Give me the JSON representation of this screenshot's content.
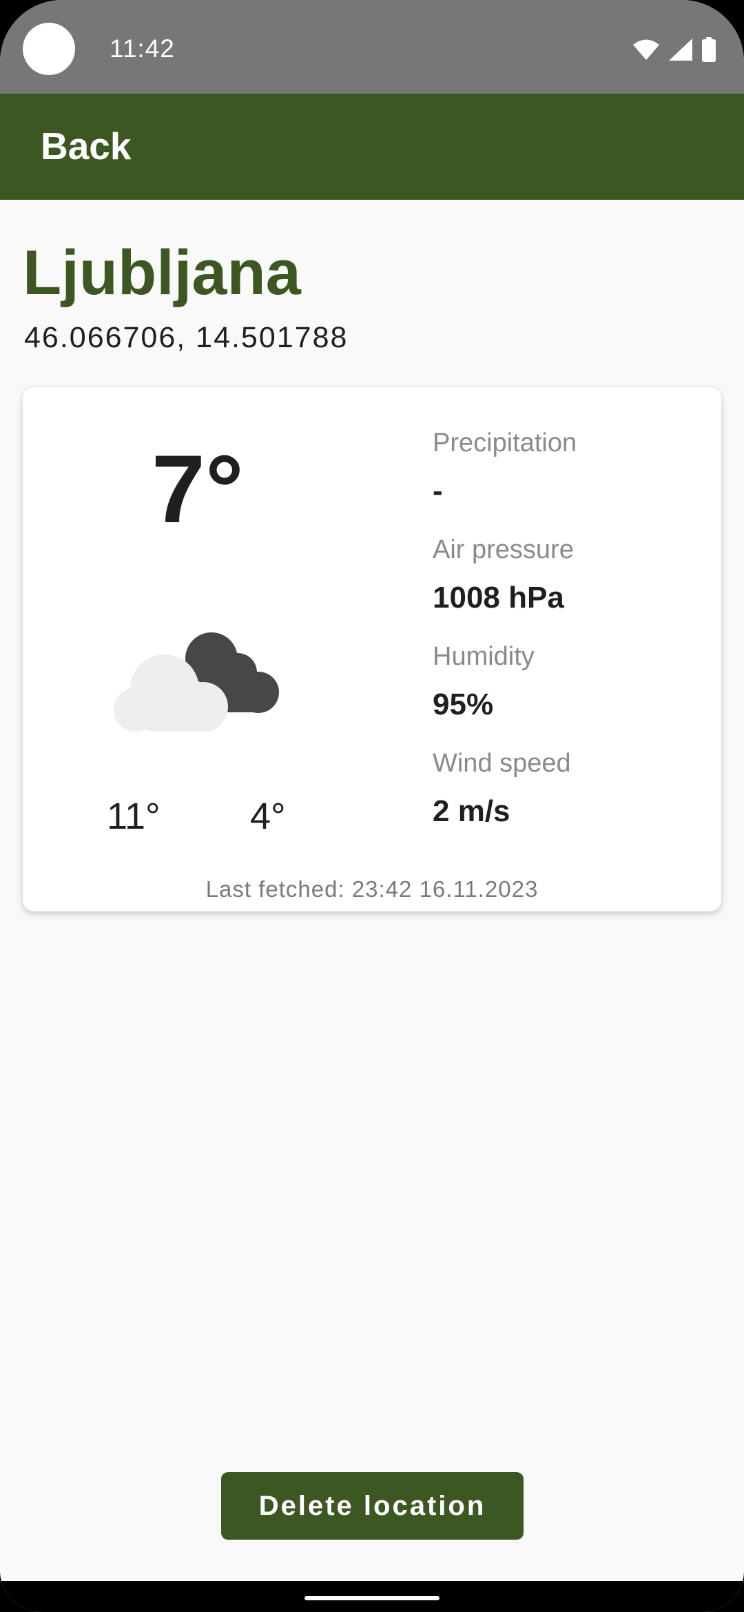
{
  "status_bar": {
    "time": "11:42",
    "icons": [
      "wifi-icon",
      "signal-icon",
      "battery-icon"
    ]
  },
  "app_bar": {
    "back_label": "Back"
  },
  "location": {
    "name": "Ljubljana",
    "coordinates": "46.066706, 14.501788"
  },
  "weather": {
    "current_temp": "7°",
    "condition_icon": "cloudy-night-icon",
    "high_temp": "11°",
    "low_temp": "4°",
    "stats": [
      {
        "label": "Precipitation",
        "value": "-"
      },
      {
        "label": "Air pressure",
        "value": "1008 hPa"
      },
      {
        "label": "Humidity",
        "value": "95%"
      },
      {
        "label": "Wind speed",
        "value": "2 m/s"
      }
    ],
    "last_fetched": "Last fetched: 23:42 16.11.2023"
  },
  "actions": {
    "delete_label": "Delete location"
  },
  "colors": {
    "primary": "#3d5723",
    "status_bar": "#777777",
    "background": "#f9f9f9"
  }
}
